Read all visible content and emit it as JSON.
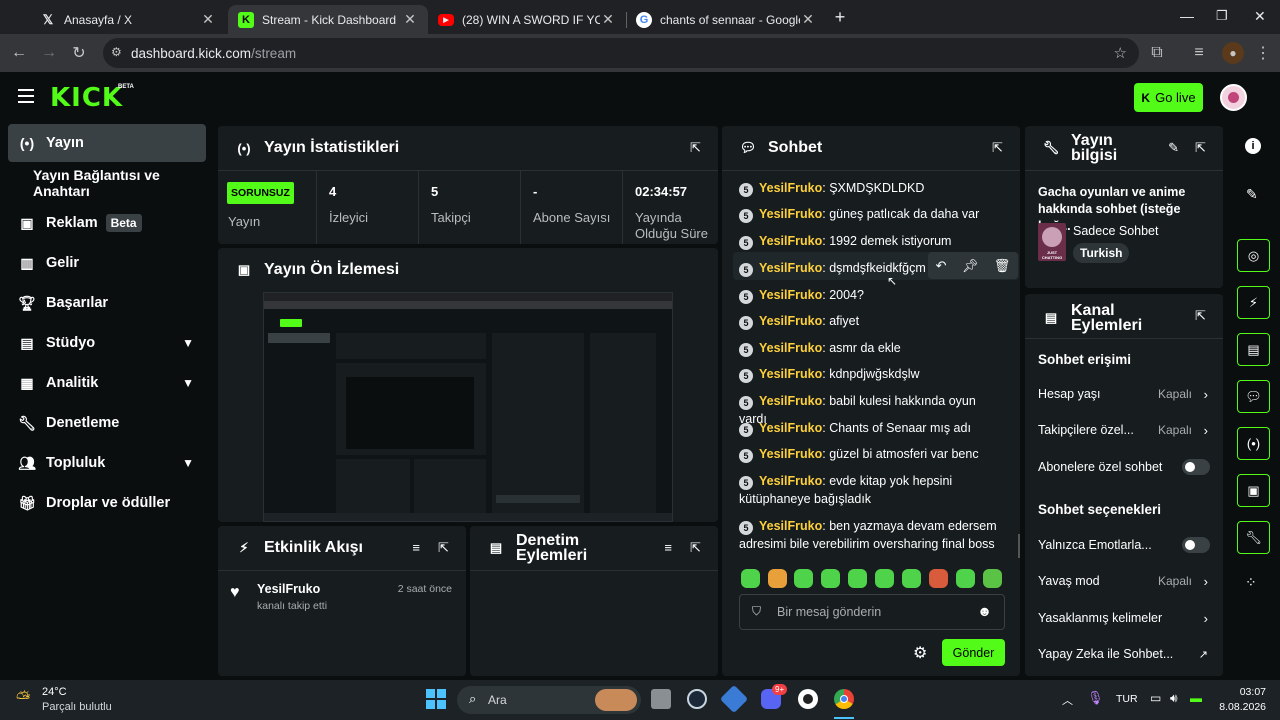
{
  "browser": {
    "tabs": [
      {
        "icon": "x-logo-icon",
        "title": "Anasayfa / X"
      },
      {
        "icon": "kick-logo-icon",
        "title": "Stream - Kick Dashboard"
      },
      {
        "icon": "youtube-icon",
        "title": "(28) WIN A SWORD IF YOU CAN"
      },
      {
        "icon": "google-icon",
        "title": "chants of sennaar - Google'da A"
      }
    ],
    "url_host": "dashboard.kick.com",
    "url_path": "/stream"
  },
  "header": {
    "logo": "KICK",
    "logo_beta": "BETA",
    "go_live": "Go live"
  },
  "sidebar": {
    "items": [
      {
        "label": "Yayın",
        "icon": "broadcast-icon"
      },
      {
        "label": "Yayın Bağlantısı ve Anahtarı",
        "icon": ""
      },
      {
        "label": "Reklam",
        "icon": "ad-icon",
        "badge": "Beta"
      },
      {
        "label": "Gelir",
        "icon": "chart-icon"
      },
      {
        "label": "Başarılar",
        "icon": "trophy-icon"
      },
      {
        "label": "Stüdyo",
        "icon": "studio-icon",
        "expand": true
      },
      {
        "label": "Analitik",
        "icon": "analytics-icon",
        "expand": true
      },
      {
        "label": "Denetleme",
        "icon": "wrench-icon"
      },
      {
        "label": "Topluluk",
        "icon": "people-icon",
        "expand": true
      },
      {
        "label": "Droplar ve ödüller",
        "icon": "gift-icon"
      }
    ]
  },
  "stats_panel": {
    "title": "Yayın İstatistikleri",
    "status_badge": "SORUNSUZ",
    "status_label": "Yayın",
    "stats": [
      {
        "value": "4",
        "label": "İzleyici"
      },
      {
        "value": "5",
        "label": "Takipçi"
      },
      {
        "value": "-",
        "label": "Abone Sayısı"
      },
      {
        "value": "02:34:57",
        "label": "Yayında Olduğu Süre"
      }
    ]
  },
  "preview_panel": {
    "title": "Yayın Ön İzlemesi"
  },
  "activity_panel": {
    "title": "Etkinlik Akışı",
    "events": [
      {
        "user": "YesilFruko",
        "text": "kanalı takip etti",
        "time": "2 saat önce"
      }
    ]
  },
  "moderation_panel": {
    "title": "Denetim Eylemleri"
  },
  "chat": {
    "title": "Sohbet",
    "messages": [
      {
        "badge": "5",
        "user": "YesilFruko",
        "text": "ŞXMDŞKDLDKD"
      },
      {
        "badge": "5",
        "user": "YesilFruko",
        "text": "güneş patlıcak da daha var"
      },
      {
        "badge": "5",
        "user": "YesilFruko",
        "text": "1992 demek istiyorum"
      },
      {
        "badge": "5",
        "user": "YesilFruko",
        "text": "dşmdşfkeidkfğçm"
      },
      {
        "badge": "5",
        "user": "YesilFruko",
        "text": "2004?"
      },
      {
        "badge": "5",
        "user": "YesilFruko",
        "text": "afiyet"
      },
      {
        "badge": "5",
        "user": "YesilFruko",
        "text": "asmr da ekle"
      },
      {
        "badge": "5",
        "user": "YesilFruko",
        "text": "kdnpdjwğskdşlw"
      },
      {
        "badge": "5",
        "user": "YesilFruko",
        "text": "babil kulesi hakkında oyun vardı"
      },
      {
        "badge": "5",
        "user": "YesilFruko",
        "text": "Chants of Senaar mış adı"
      },
      {
        "badge": "5",
        "user": "YesilFruko",
        "text": "güzel bi atmosferi var benc"
      },
      {
        "badge": "5",
        "user": "YesilFruko",
        "text": "evde kitap yok hepsini kütüphaneye bağışladık"
      },
      {
        "badge": "5",
        "user": "YesilFruko",
        "text": "ben yazmaya devam edersem adresimi bile verebilirim oversharing final boss"
      }
    ],
    "input_placeholder": "Bir mesaj gönderin",
    "send": "Gönder"
  },
  "stream_info": {
    "title": "Yayın bilgisi",
    "stream_title": "Gacha oyunları ve anime hakkında sohbet (isteğe bağ...",
    "category": "Sadece Sohbet",
    "language": "Turkish",
    "thumb_text": "JUST CHATTING"
  },
  "channel_actions": {
    "title": "Kanal Eylemleri",
    "chat_access": "Sohbet erişimi",
    "rows1": [
      {
        "label": "Hesap yaşı",
        "value": "Kapalı"
      },
      {
        "label": "Takipçilere özel...",
        "value": "Kapalı"
      },
      {
        "label": "Abonelere özel sohbet",
        "value": ""
      }
    ],
    "chat_options": "Sohbet seçenekleri",
    "rows2": [
      {
        "label": "Yalnızca Emotlarla...",
        "value": ""
      },
      {
        "label": "Yavaş mod",
        "value": "Kapalı"
      },
      {
        "label": "Yasaklanmış kelimeler",
        "value": ""
      },
      {
        "label": "Yapay Zeka ile Sohbet...",
        "value": ""
      }
    ]
  },
  "taskbar": {
    "temp": "24°C",
    "weather": "Parçalı bulutlu",
    "search": "Ara",
    "lang": "TUR",
    "time": "03:07",
    "date": "8.08.2026",
    "discord_badge": "9+"
  },
  "colors": {
    "accent": "#53fc18",
    "panel": "#171c1e",
    "username": "#fdd03c"
  }
}
